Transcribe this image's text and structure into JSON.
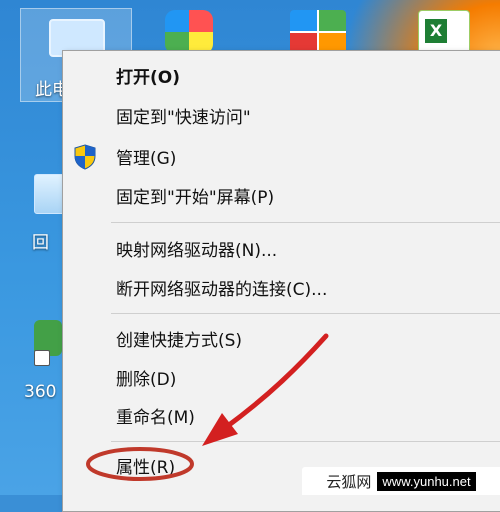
{
  "desktop": {
    "icons": [
      {
        "id": "this-pc",
        "label": "此电"
      },
      {
        "id": "recycle",
        "label": "回"
      },
      {
        "id": "browser-360",
        "label": "360"
      }
    ]
  },
  "context_menu": {
    "items": [
      {
        "id": "open",
        "label": "打开(O)",
        "bold": true
      },
      {
        "id": "pin-quick-access",
        "label": "固定到\"快速访问\""
      },
      {
        "id": "manage",
        "label": "管理(G)",
        "icon": "uac-shield-icon"
      },
      {
        "id": "pin-start",
        "label": "固定到\"开始\"屏幕(P)"
      },
      {
        "id": "map-drive",
        "label": "映射网络驱动器(N)..."
      },
      {
        "id": "disconnect-drive",
        "label": "断开网络驱动器的连接(C)..."
      },
      {
        "id": "create-shortcut",
        "label": "创建快捷方式(S)"
      },
      {
        "id": "delete",
        "label": "删除(D)"
      },
      {
        "id": "rename",
        "label": "重命名(M)"
      },
      {
        "id": "properties",
        "label": "属性(R)"
      }
    ]
  },
  "annotation": {
    "arrow_color": "#d32020",
    "circle_color": "#c0392b"
  },
  "watermark": {
    "site": "云狐网",
    "url": "www.yunhu.net"
  }
}
